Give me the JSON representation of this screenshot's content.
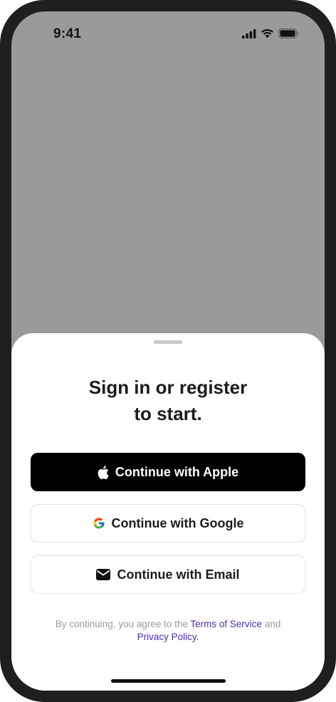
{
  "status_bar": {
    "time": "9:41",
    "icons": [
      "cellular-signal-icon",
      "wifi-icon",
      "battery-icon"
    ]
  },
  "sheet": {
    "title_line1": "Sign in or register",
    "title_line2": "to start.",
    "buttons": {
      "apple": {
        "label": "Continue with Apple",
        "icon": "apple-logo-icon"
      },
      "google": {
        "label": "Continue with Google",
        "icon": "google-logo-icon"
      },
      "email": {
        "label": "Continue with Email",
        "icon": "envelope-icon"
      }
    },
    "legal": {
      "prefix": "By continuing, you agree to the ",
      "terms_link": "Terms of Service",
      "middle": " and",
      "privacy_link": "Privacy Policy."
    }
  },
  "colors": {
    "apple_button_bg": "#000000",
    "link": "#4b2bbd",
    "backdrop": "#9a9a9c"
  }
}
